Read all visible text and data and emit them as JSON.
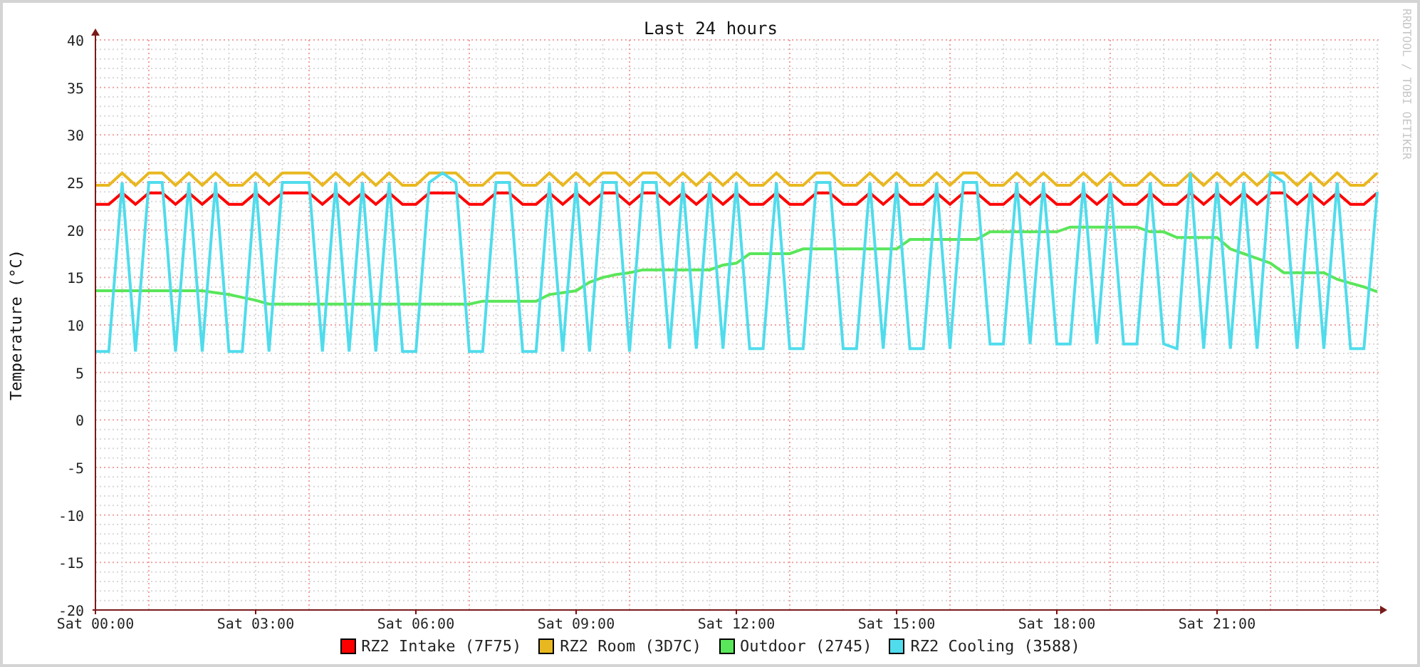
{
  "graph": {
    "watermark": "RRDTOOL / TOBI OETIKER",
    "chart_data": {
      "type": "line",
      "grid": true,
      "title": "Last 24 hours",
      "ylabel": "Temperature (°C)",
      "ylim": [
        -20,
        40
      ],
      "yticks": [
        -20,
        -15,
        -10,
        -5,
        0,
        5,
        10,
        15,
        20,
        25,
        30,
        35,
        40
      ],
      "categories": [
        "Sat 00:00",
        null,
        null,
        null,
        null,
        null,
        null,
        null,
        null,
        null,
        null,
        null,
        "Sat 03:00",
        null,
        null,
        null,
        null,
        null,
        null,
        null,
        null,
        null,
        null,
        null,
        "Sat 06:00",
        null,
        null,
        null,
        null,
        null,
        null,
        null,
        null,
        null,
        null,
        null,
        "Sat 09:00",
        null,
        null,
        null,
        null,
        null,
        null,
        null,
        null,
        null,
        null,
        null,
        "Sat 12:00",
        null,
        null,
        null,
        null,
        null,
        null,
        null,
        null,
        null,
        null,
        null,
        "Sat 15:00",
        null,
        null,
        null,
        null,
        null,
        null,
        null,
        null,
        null,
        null,
        null,
        "Sat 18:00",
        null,
        null,
        null,
        null,
        null,
        null,
        null,
        null,
        null,
        null,
        null,
        "Sat 21:00",
        null,
        null,
        null,
        null,
        null,
        null,
        null,
        null,
        null,
        null,
        null,
        null
      ],
      "series": [
        {
          "name": "RZ2 Intake (7F75)",
          "color": "#ff0000",
          "values": [
            22.7,
            22.7,
            23.9,
            22.7,
            23.9,
            23.9,
            22.7,
            23.9,
            22.7,
            23.9,
            22.7,
            22.7,
            23.9,
            22.7,
            23.9,
            23.9,
            23.9,
            22.7,
            23.9,
            22.7,
            23.9,
            22.7,
            23.9,
            22.7,
            22.7,
            23.9,
            23.9,
            23.9,
            22.7,
            22.7,
            23.9,
            23.9,
            22.7,
            22.7,
            23.9,
            22.7,
            23.9,
            22.7,
            23.9,
            23.9,
            22.7,
            23.9,
            23.9,
            22.7,
            23.9,
            22.7,
            23.9,
            22.7,
            23.9,
            22.7,
            22.7,
            23.9,
            22.7,
            22.7,
            23.9,
            23.9,
            22.7,
            22.7,
            23.9,
            22.7,
            23.9,
            22.7,
            22.7,
            23.9,
            22.7,
            23.9,
            23.9,
            22.7,
            22.7,
            23.9,
            22.7,
            23.9,
            22.7,
            22.7,
            23.9,
            22.7,
            23.9,
            22.7,
            22.7,
            23.9,
            22.7,
            22.7,
            23.9,
            22.7,
            23.9,
            22.7,
            23.9,
            22.7,
            23.9,
            23.9,
            22.7,
            23.9,
            22.7,
            23.9,
            22.7,
            22.7,
            23.9
          ]
        },
        {
          "name": "RZ2 Room (3D7C)",
          "color": "#e8b820",
          "values": [
            24.7,
            24.7,
            26,
            24.7,
            26,
            26,
            24.7,
            26,
            24.7,
            26,
            24.7,
            24.7,
            26,
            24.7,
            26,
            26,
            26,
            24.7,
            26,
            24.7,
            26,
            24.7,
            26,
            24.7,
            24.7,
            26,
            26,
            26,
            24.7,
            24.7,
            26,
            26,
            24.7,
            24.7,
            26,
            24.7,
            26,
            24.7,
            26,
            26,
            24.7,
            26,
            26,
            24.7,
            26,
            24.7,
            26,
            24.7,
            26,
            24.7,
            24.7,
            26,
            24.7,
            24.7,
            26,
            26,
            24.7,
            24.7,
            26,
            24.7,
            26,
            24.7,
            24.7,
            26,
            24.7,
            26,
            26,
            24.7,
            24.7,
            26,
            24.7,
            26,
            24.7,
            24.7,
            26,
            24.7,
            26,
            24.7,
            24.7,
            26,
            24.7,
            24.7,
            26,
            24.7,
            26,
            24.7,
            26,
            24.7,
            26,
            26,
            24.7,
            26,
            24.7,
            26,
            24.7,
            24.7,
            26
          ]
        },
        {
          "name": "Outdoor (2745)",
          "color": "#5ae65a",
          "values": [
            13.6,
            13.6,
            13.6,
            13.6,
            13.6,
            13.6,
            13.6,
            13.6,
            13.6,
            13.4,
            13.2,
            12.9,
            12.6,
            12.2,
            12.2,
            12.2,
            12.2,
            12.2,
            12.2,
            12.2,
            12.2,
            12.2,
            12.2,
            12.2,
            12.2,
            12.2,
            12.2,
            12.2,
            12.2,
            12.5,
            12.5,
            12.5,
            12.5,
            12.5,
            13.2,
            13.4,
            13.6,
            14.5,
            15,
            15.3,
            15.5,
            15.8,
            15.8,
            15.8,
            15.8,
            15.8,
            15.8,
            16.3,
            16.5,
            17.5,
            17.5,
            17.5,
            17.5,
            18,
            18,
            18,
            18,
            18,
            18,
            18,
            18,
            19,
            19,
            19,
            19,
            19,
            19,
            19.8,
            19.8,
            19.8,
            19.8,
            19.8,
            19.8,
            20.3,
            20.3,
            20.3,
            20.3,
            20.3,
            20.3,
            19.8,
            19.8,
            19.2,
            19.2,
            19.2,
            19.2,
            18,
            17.5,
            17,
            16.5,
            15.5,
            15.5,
            15.5,
            15.5,
            14.8,
            14.4,
            14,
            13.5
          ]
        },
        {
          "name": "RZ2 Cooling (3588)",
          "color": "#50dcec",
          "values": [
            7.2,
            7.2,
            25,
            7.2,
            25,
            25,
            7.2,
            25,
            7.2,
            25,
            7.2,
            7.2,
            25,
            7.2,
            25,
            25,
            25,
            7.2,
            25,
            7.2,
            25,
            7.2,
            25,
            7.2,
            7.2,
            25,
            26,
            25,
            7.2,
            7.2,
            25,
            25,
            7.2,
            7.2,
            25,
            7.2,
            25,
            7.2,
            25,
            25,
            7.2,
            25,
            25,
            7.5,
            25,
            7.5,
            25,
            7.5,
            25,
            7.5,
            7.5,
            25,
            7.5,
            7.5,
            25,
            25,
            7.5,
            7.5,
            25,
            7.5,
            25,
            7.5,
            7.5,
            25,
            7.5,
            25,
            25,
            8,
            8,
            25,
            8,
            25,
            8,
            8,
            25,
            8,
            25,
            8,
            8,
            25,
            8,
            7.5,
            26,
            7.5,
            25,
            7.5,
            25,
            7.5,
            26,
            25,
            7.5,
            25,
            7.5,
            25,
            7.5,
            7.5,
            24
          ]
        }
      ]
    }
  }
}
